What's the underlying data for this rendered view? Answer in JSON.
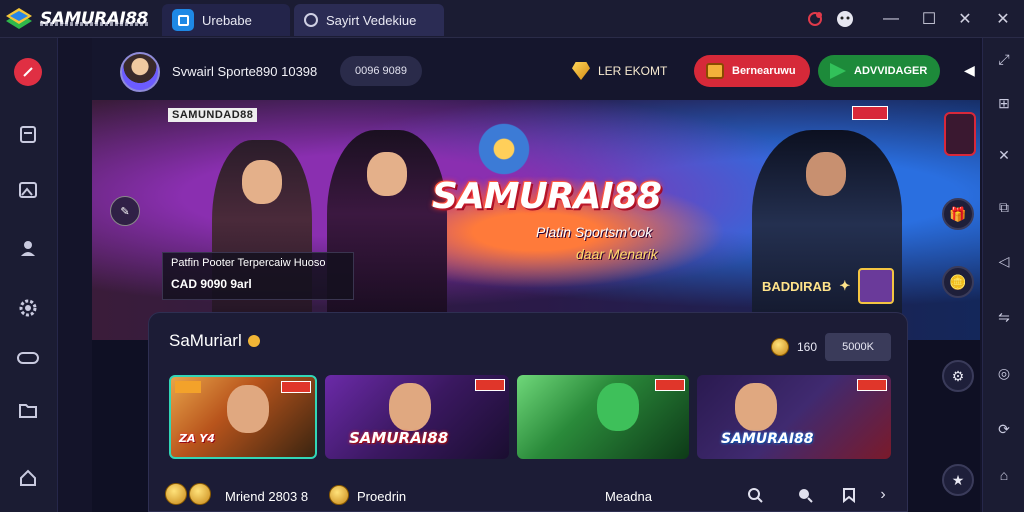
{
  "app": {
    "title": "SAMURAI88",
    "tabs": [
      {
        "label": "Urebabe"
      },
      {
        "label": "Sayirt Vedekiue"
      }
    ]
  },
  "window_controls": {
    "minimize": "—",
    "maximize": "☐",
    "close": "✕",
    "extra": "✕"
  },
  "topbar": {
    "username": "Svwairl Sporte890 10398",
    "chip": "0096 9089",
    "balance": "LER EKOMT",
    "deposit_label": "Bernearuwu",
    "download_label": "ADVVIDAGER"
  },
  "banner": {
    "tag_left": "SAMUNDAD88",
    "brand": "SAMURAI88",
    "subtitle1": "Platin Sportsm'ook",
    "subtitle2": "daar Menarik",
    "promo_line1": "Patfin Pooter Terpercaiw Huoso",
    "promo_line2": "CAD 9090 9arl",
    "reward": "BADDIRAB"
  },
  "panel": {
    "title": "SaMuriarl",
    "balance_value": "160",
    "balance_chip": "5000K",
    "games": [
      {
        "label": "ZA Y4"
      },
      {
        "label": "SAMURAI88"
      },
      {
        "label": ""
      },
      {
        "label": "SAMURAI88"
      }
    ],
    "bottom": {
      "label1": "Mriend 2803 8",
      "label2": "Proedrin",
      "label3": "Meadna"
    }
  },
  "colors": {
    "accent_red": "#d62939",
    "accent_green": "#1d8a3a",
    "gold": "#f1b536",
    "bg": "#14142a"
  },
  "icons": {
    "left_sidebar": [
      "pen-icon",
      "clipboard-icon",
      "image-icon",
      "user-icon",
      "gear-icon",
      "controller-icon",
      "folder-icon",
      "home-icon"
    ],
    "right_sidebar": [
      "expand-icon",
      "grid-icon",
      "shuffle-icon",
      "copy-icon",
      "back-icon",
      "link-icon",
      "refresh-icon",
      "rotate-icon"
    ]
  }
}
